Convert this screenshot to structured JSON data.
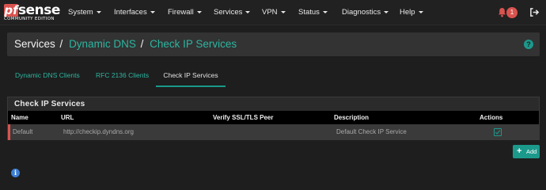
{
  "navbar": {
    "logo": {
      "pf": "pf",
      "sense": "sense",
      "edition": "COMMUNITY EDITION"
    },
    "menus": [
      "System",
      "Interfaces",
      "Firewall",
      "Services",
      "VPN",
      "Status",
      "Diagnostics",
      "Help"
    ],
    "notification_count": "1",
    "icons": {
      "notifications": "bell-icon",
      "logout": "logout-icon"
    }
  },
  "breadcrumb": {
    "root": "Services",
    "sep": "/",
    "items": [
      "Dynamic DNS",
      "Check IP Services"
    ],
    "help_icon": "help-icon",
    "help_glyph": "?"
  },
  "tabs": [
    {
      "label": "Dynamic DNS Clients",
      "active": false
    },
    {
      "label": "RFC 2136 Clients",
      "active": false
    },
    {
      "label": "Check IP Services",
      "active": true
    }
  ],
  "panel": {
    "title": "Check IP Services",
    "columns": [
      "Name",
      "URL",
      "Verify SSL/TLS Peer",
      "Description",
      "Actions"
    ],
    "rows": [
      {
        "name": "Default",
        "url": "http://checkip.dyndns.org",
        "verify": "",
        "description": "Default Check IP Service",
        "action_icon": "check-square-icon"
      }
    ]
  },
  "add_button": {
    "label": "Add",
    "icon": "plus-icon",
    "glyph": "+"
  },
  "info_glyph": "i",
  "colors": {
    "accent": "#1b998b",
    "link": "#2cb5a0",
    "danger": "#d9534f",
    "info": "#3d7fd4",
    "background": "#1e1e1e"
  }
}
